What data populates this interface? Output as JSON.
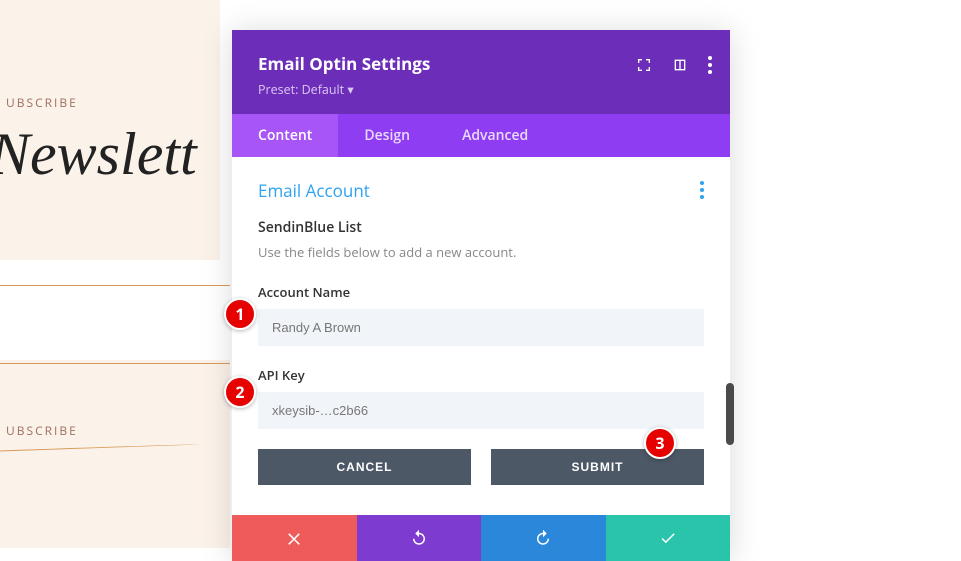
{
  "background": {
    "subscribe": "UBSCRIBE",
    "newsletter": "Newslett"
  },
  "modal": {
    "title": "Email Optin Settings",
    "preset": "Preset: Default ▾",
    "tabs": {
      "content": "Content",
      "design": "Design",
      "advanced": "Advanced"
    },
    "section": {
      "title": "Email Account",
      "list_name": "SendinBlue List",
      "list_desc": "Use the fields below to add a new account."
    },
    "fields": {
      "account_label": "Account Name",
      "account_value": "Randy A Brown",
      "api_label": "API Key",
      "api_value": "xkeysib-…c2b66"
    },
    "buttons": {
      "cancel": "CANCEL",
      "submit": "SUBMIT"
    }
  },
  "callouts": {
    "one": "1",
    "two": "2",
    "three": "3"
  }
}
